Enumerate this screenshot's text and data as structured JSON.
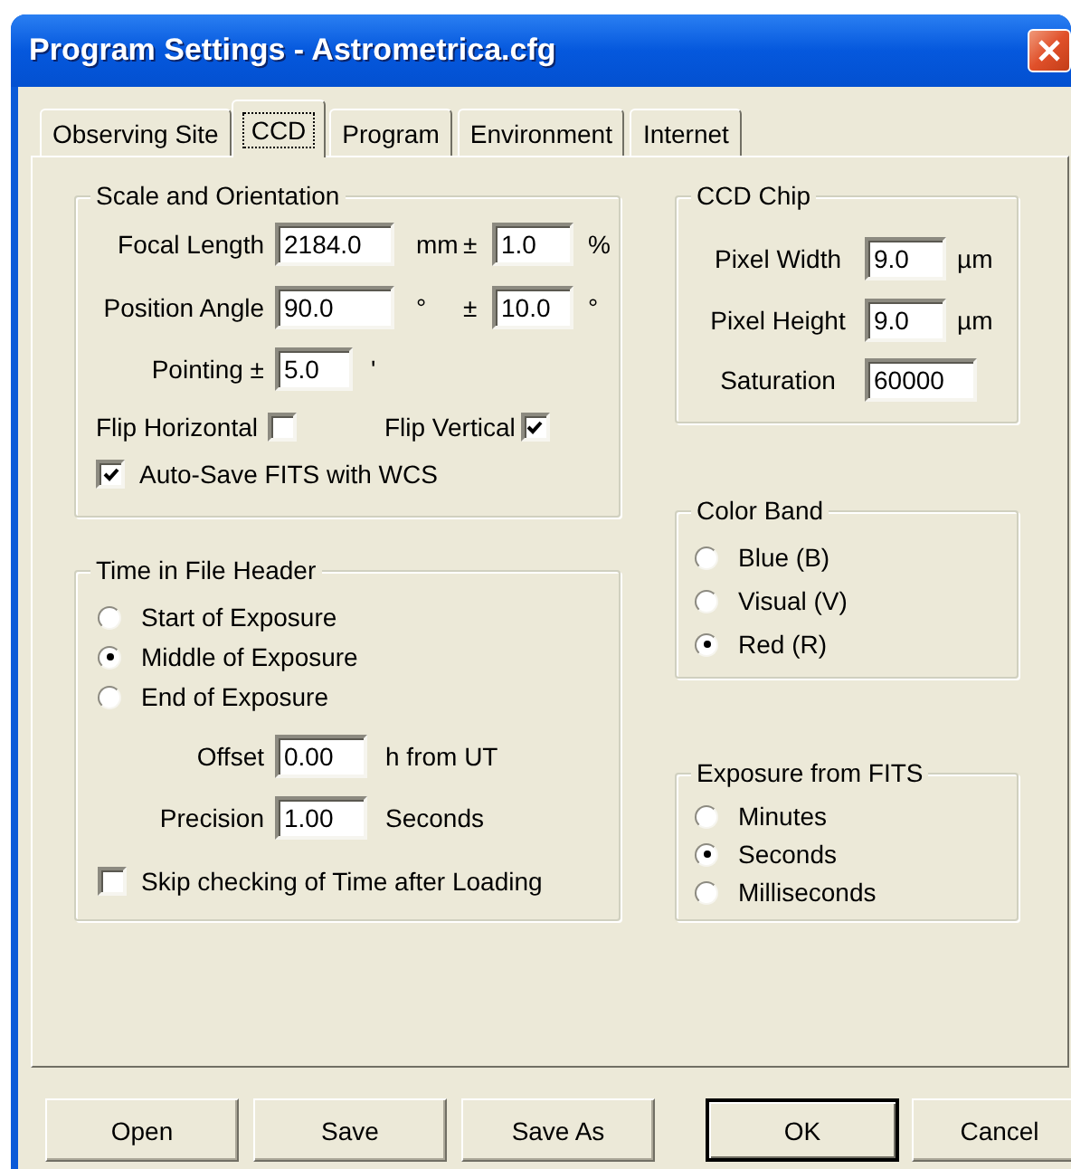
{
  "window": {
    "title": "Program Settings - Astrometrica.cfg"
  },
  "tabs": [
    {
      "label": "Observing Site",
      "selected": false
    },
    {
      "label": "CCD",
      "selected": true
    },
    {
      "label": "Program",
      "selected": false
    },
    {
      "label": "Environment",
      "selected": false
    },
    {
      "label": "Internet",
      "selected": false
    }
  ],
  "scale_orientation": {
    "title": "Scale and Orientation",
    "focal_length": {
      "label": "Focal Length",
      "value": "2184.0",
      "unit": "mm",
      "tolerance_sign": "±",
      "tolerance": "1.0",
      "tolerance_unit": "%"
    },
    "position_angle": {
      "label": "Position Angle",
      "value": "90.0",
      "unit": "°",
      "tolerance_sign": "±",
      "tolerance": "10.0",
      "tolerance_unit": "°"
    },
    "pointing": {
      "label": "Pointing ±",
      "value": "5.0",
      "unit": "'"
    },
    "flip_horizontal": {
      "label": "Flip Horizontal",
      "checked": false
    },
    "flip_vertical": {
      "label": "Flip Vertical",
      "checked": true
    },
    "auto_save": {
      "label": "Auto-Save FITS with WCS",
      "checked": true
    }
  },
  "time_header": {
    "title": "Time in File Header",
    "options": [
      {
        "label": "Start of Exposure",
        "selected": false
      },
      {
        "label": "Middle of Exposure",
        "selected": true
      },
      {
        "label": "End of Exposure",
        "selected": false
      }
    ],
    "offset": {
      "label": "Offset",
      "value": "0.00",
      "unit": "h from UT"
    },
    "precision": {
      "label": "Precision",
      "value": "1.00",
      "unit": "Seconds"
    },
    "skip_check": {
      "label": "Skip checking of Time after Loading",
      "checked": false
    }
  },
  "ccd_chip": {
    "title": "CCD Chip",
    "pixel_width": {
      "label": "Pixel Width",
      "value": "9.0",
      "unit": "µm"
    },
    "pixel_height": {
      "label": "Pixel Height",
      "value": "9.0",
      "unit": "µm"
    },
    "saturation": {
      "label": "Saturation",
      "value": "60000"
    }
  },
  "color_band": {
    "title": "Color Band",
    "options": [
      {
        "label": "Blue (B)",
        "selected": false
      },
      {
        "label": "Visual (V)",
        "selected": false
      },
      {
        "label": "Red (R)",
        "selected": true
      }
    ]
  },
  "exposure": {
    "title": "Exposure from FITS",
    "options": [
      {
        "label": "Minutes",
        "selected": false
      },
      {
        "label": "Seconds",
        "selected": true
      },
      {
        "label": "Milliseconds",
        "selected": false
      }
    ]
  },
  "buttons": [
    {
      "label": "Open",
      "default": false
    },
    {
      "label": "Save",
      "default": false
    },
    {
      "label": "Save As",
      "default": false
    },
    {
      "label": "OK",
      "default": true
    },
    {
      "label": "Cancel",
      "default": false
    }
  ]
}
